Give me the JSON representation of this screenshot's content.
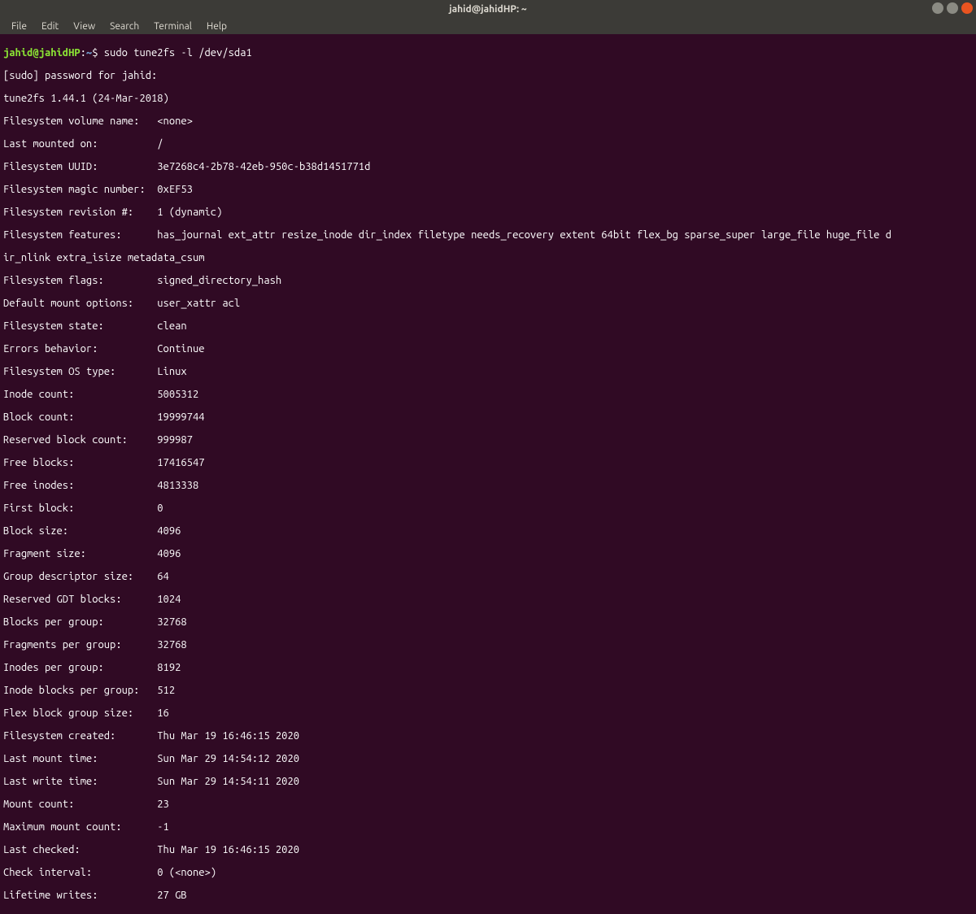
{
  "titlebar": {
    "title": "jahid@jahidHP: ~"
  },
  "menubar": {
    "file": "File",
    "edit": "Edit",
    "view": "View",
    "search": "Search",
    "terminal": "Terminal",
    "help": "Help"
  },
  "prompt": {
    "user_host": "jahid@jahidHP",
    "colon": ":",
    "path": "~",
    "dollar": "$ ",
    "command": "sudo tune2fs -l /dev/sda1"
  },
  "lines": {
    "sudo_prompt": "[sudo] password for jahid: ",
    "version": "tune2fs 1.44.1 (24-Mar-2018)",
    "features_wrap": "ir_nlink extra_isize metadata_csum"
  },
  "fields": [
    {
      "k": "Filesystem volume name:   ",
      "v": "<none>"
    },
    {
      "k": "Last mounted on:          ",
      "v": "/"
    },
    {
      "k": "Filesystem UUID:          ",
      "v": "3e7268c4-2b78-42eb-950c-b38d1451771d"
    },
    {
      "k": "Filesystem magic number:  ",
      "v": "0xEF53"
    },
    {
      "k": "Filesystem revision #:    ",
      "v": "1 (dynamic)"
    },
    {
      "k": "Filesystem features:      ",
      "v": "has_journal ext_attr resize_inode dir_index filetype needs_recovery extent 64bit flex_bg sparse_super large_file huge_file d"
    },
    {
      "k": "Filesystem flags:         ",
      "v": "signed_directory_hash "
    },
    {
      "k": "Default mount options:    ",
      "v": "user_xattr acl"
    },
    {
      "k": "Filesystem state:         ",
      "v": "clean"
    },
    {
      "k": "Errors behavior:          ",
      "v": "Continue"
    },
    {
      "k": "Filesystem OS type:       ",
      "v": "Linux"
    },
    {
      "k": "Inode count:              ",
      "v": "5005312"
    },
    {
      "k": "Block count:              ",
      "v": "19999744"
    },
    {
      "k": "Reserved block count:     ",
      "v": "999987"
    },
    {
      "k": "Free blocks:              ",
      "v": "17416547"
    },
    {
      "k": "Free inodes:              ",
      "v": "4813338"
    },
    {
      "k": "First block:              ",
      "v": "0"
    },
    {
      "k": "Block size:               ",
      "v": "4096"
    },
    {
      "k": "Fragment size:            ",
      "v": "4096"
    },
    {
      "k": "Group descriptor size:    ",
      "v": "64"
    },
    {
      "k": "Reserved GDT blocks:      ",
      "v": "1024"
    },
    {
      "k": "Blocks per group:         ",
      "v": "32768"
    },
    {
      "k": "Fragments per group:      ",
      "v": "32768"
    },
    {
      "k": "Inodes per group:         ",
      "v": "8192"
    },
    {
      "k": "Inode blocks per group:   ",
      "v": "512"
    },
    {
      "k": "Flex block group size:    ",
      "v": "16"
    },
    {
      "k": "Filesystem created:       ",
      "v": "Thu Mar 19 16:46:15 2020"
    },
    {
      "k": "Last mount time:          ",
      "v": "Sun Mar 29 14:54:12 2020"
    },
    {
      "k": "Last write time:          ",
      "v": "Sun Mar 29 14:54:11 2020"
    },
    {
      "k": "Mount count:              ",
      "v": "23"
    },
    {
      "k": "Maximum mount count:      ",
      "v": "-1"
    },
    {
      "k": "Last checked:             ",
      "v": "Thu Mar 19 16:46:15 2020"
    },
    {
      "k": "Check interval:           ",
      "v": "0 (<none>)"
    },
    {
      "k": "Lifetime writes:          ",
      "v": "27 GB"
    }
  ]
}
